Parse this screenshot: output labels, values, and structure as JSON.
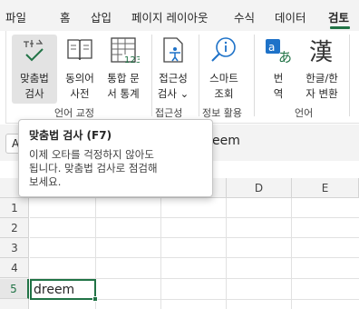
{
  "tabs": [
    {
      "label": "파일"
    },
    {
      "label": "홈"
    },
    {
      "label": "삽입"
    },
    {
      "label": "페이지 레이아웃"
    },
    {
      "label": "수식"
    },
    {
      "label": "데이터"
    },
    {
      "label": "검토",
      "active": true
    }
  ],
  "ribbon": {
    "buttons": [
      {
        "label": "맞춤법\n검사",
        "icon": "spell-check-icon"
      },
      {
        "label": "동의어\n사전",
        "icon": "thesaurus-book-icon"
      },
      {
        "label": "통합 문\n서 통계",
        "icon": "workbook-statistics-icon"
      },
      {
        "label": "접근성\n검사 ⌄",
        "icon": "accessibility-check-icon"
      },
      {
        "label": "스마트\n조회",
        "icon": "smart-lookup-icon"
      },
      {
        "label": "번\n역",
        "icon": "translate-icon"
      },
      {
        "label": "한글/한\n자 변환",
        "icon": "hanja-convert-icon"
      }
    ],
    "groups": [
      "언어 교정",
      "접근성",
      "정보 활용",
      "언어"
    ]
  },
  "formula_bar": {
    "name_box": "A",
    "value": "eem"
  },
  "columns": [
    "D",
    "E"
  ],
  "rows": [
    "1",
    "2",
    "3",
    "4",
    "5"
  ],
  "active_cell": {
    "value": "dreem"
  },
  "tooltip": {
    "title": "맞춤법 검사 (F7)",
    "body": "이제 오타를 걱정하지 않아도\n됩니다. 맞춤법 검사로 점검해\n보세요."
  },
  "colors": {
    "accent": "#217346",
    "tab_bar": "#f3f3f3"
  }
}
